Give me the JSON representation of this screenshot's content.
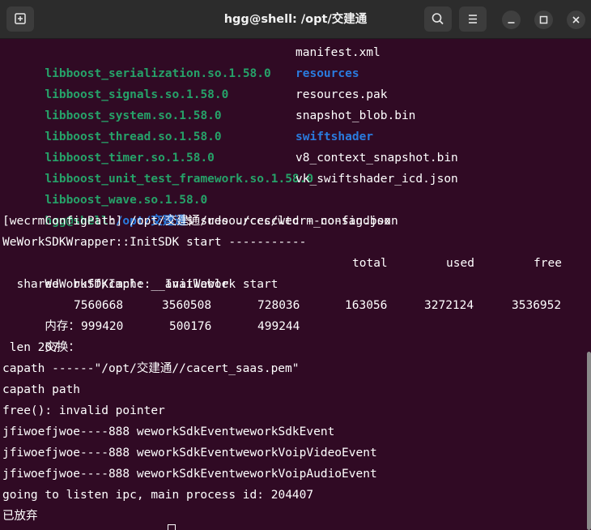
{
  "window": {
    "title": "hgg@shell: /opt/交建通",
    "icons": {
      "new_tab": "new-tab-icon",
      "search": "search-icon",
      "menu": "hamburger-menu-icon",
      "minimize": "minimize-icon",
      "maximize": "maximize-icon",
      "close": "close-icon"
    }
  },
  "colors": {
    "background": "#300a24",
    "library_green": "#26a269",
    "directory_blue": "#2a7bde",
    "text": "#ffffff"
  },
  "listing": [
    {
      "left": "libboost_serialization.so.1.58.0",
      "right": "manifest.xml",
      "right_is_dir": false
    },
    {
      "left": "libboost_signals.so.1.58.0",
      "right": "resources",
      "right_is_dir": true
    },
    {
      "left": "libboost_system.so.1.58.0",
      "right": "resources.pak",
      "right_is_dir": false
    },
    {
      "left": "libboost_thread.so.1.58.0",
      "right": "snapshot_blob.bin",
      "right_is_dir": false
    },
    {
      "left": "libboost_timer.so.1.58.0",
      "right": "swiftshader",
      "right_is_dir": true
    },
    {
      "left": "libboost_unit_test_framework.so.1.58.0",
      "right": "v8_context_snapshot.bin",
      "right_is_dir": false
    },
    {
      "left": "libboost_wave.so.1.58.0",
      "right": "vk_swiftshader_icd.json",
      "right_is_dir": false
    }
  ],
  "prompt": {
    "user_host": "hgg@shell",
    "separator": ":",
    "path": "/opt/交建通",
    "symbol": "$",
    "command": " sudo ./ccccltd --no-sandbox"
  },
  "output": {
    "config_path": "[wecrmConfigPath] /opt/交建通/resources/wecrm_config.json",
    "init_sdk": "WeWorkSDKWrapper::InitSDK start -----------",
    "init_wework": "WeWorkSDKImpl::__InitWework start",
    "mem_headers_row1": [
      "total",
      "used",
      "free"
    ],
    "mem_headers_row2": "  shared  buff/cache   available",
    "mem_row": {
      "label": "内存：",
      "values": [
        "7560668",
        "3560508",
        "728036",
        "163056",
        "3272124",
        "3536952"
      ]
    },
    "swap_row": {
      "label": "交换：",
      "values": [
        "999420",
        "500176",
        "499244"
      ]
    },
    "len_line": " len 207",
    "capath_line": "capath ------\"/opt/交建通//cacert_saas.pem\"",
    "capath_path": "capath path",
    "free_error": "free(): invalid pointer",
    "events": [
      "jfiwoefjwoe----888 weworkSdkEventweworkSdkEvent",
      "jfiwoefjwoe----888 weworkSdkEventweworkVoipVideoEvent",
      "jfiwoefjwoe----888 weworkSdkEventweworkVoipAudioEvent"
    ],
    "listen_line": "going to listen ipc, main process id: 204407",
    "aborted": "已放弃"
  }
}
